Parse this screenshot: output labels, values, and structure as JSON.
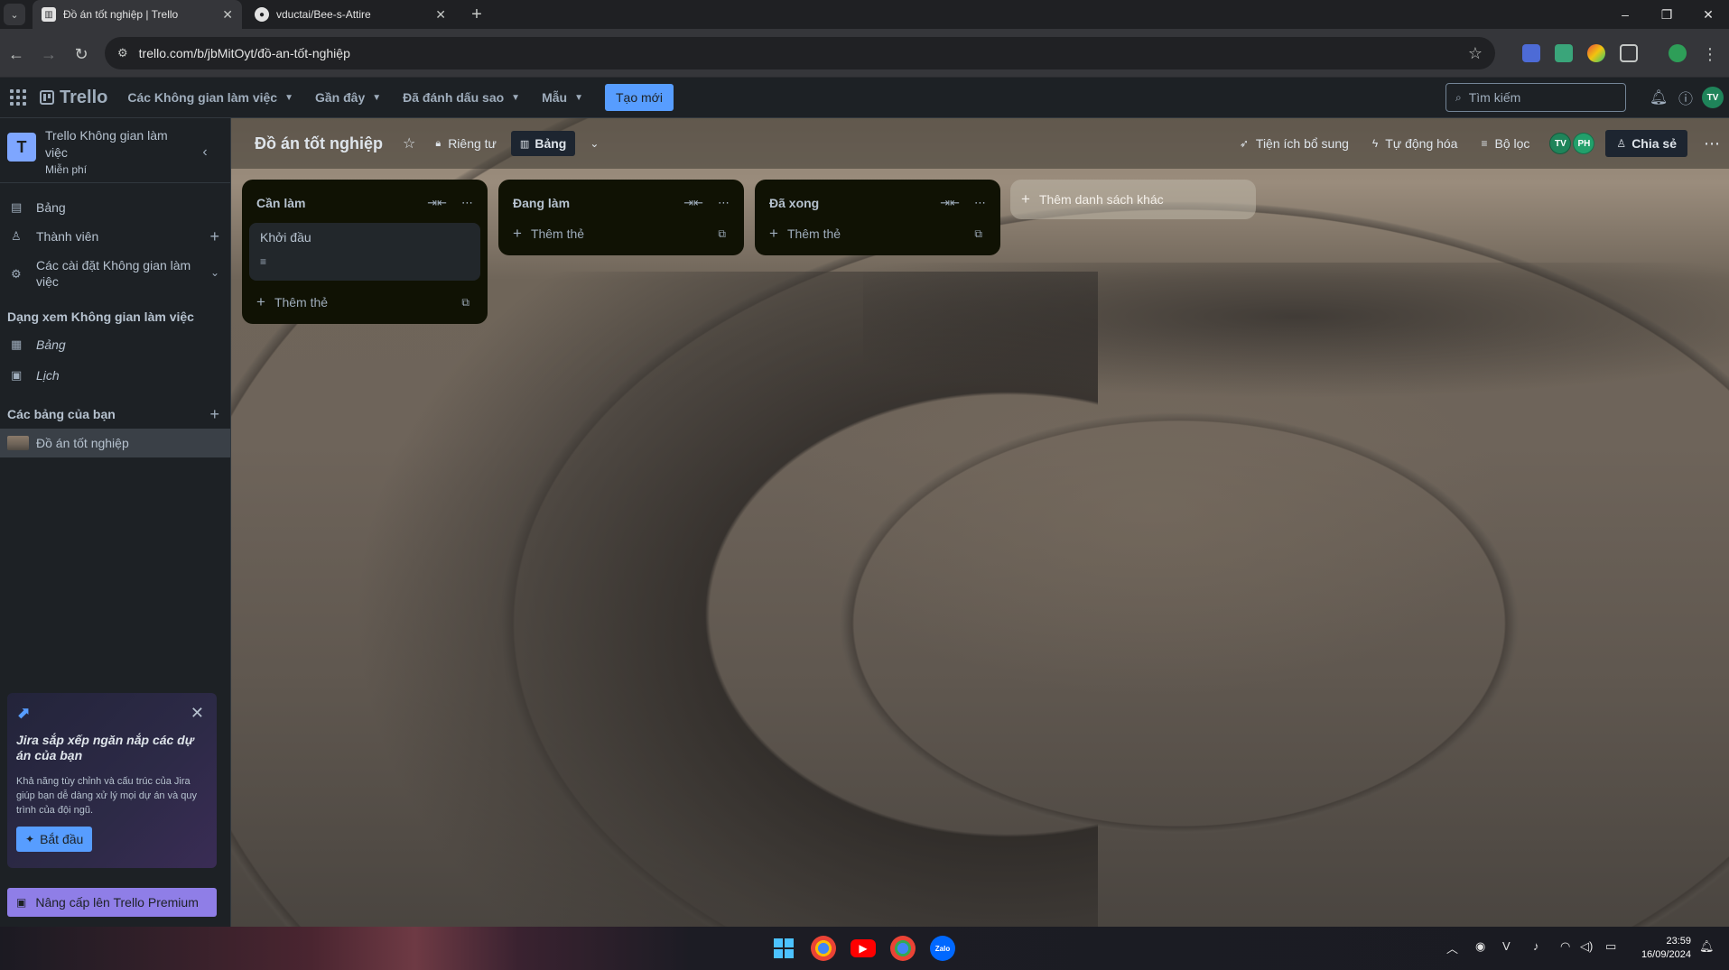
{
  "browser": {
    "tabs": [
      {
        "title": "Đồ án tốt nghiệp | Trello",
        "active": true,
        "favicon": "trello-icon"
      },
      {
        "title": "vductai/Bee-s-Attire",
        "active": false,
        "favicon": "github-icon"
      }
    ],
    "url": "trello.com/b/jbMitOyt/đồ-an-tốt-nghiệp",
    "window_controls": {
      "minimize": "–",
      "restore": "❐",
      "close": "✕"
    }
  },
  "header": {
    "logo": "Trello",
    "menus": [
      {
        "label": "Các Không gian làm việc"
      },
      {
        "label": "Gần đây"
      },
      {
        "label": "Đã đánh dấu sao"
      },
      {
        "label": "Mẫu"
      }
    ],
    "create_label": "Tạo mới",
    "search_placeholder": "Tìm kiếm",
    "user_initials": "TV"
  },
  "sidebar": {
    "workspace": {
      "initial": "T",
      "name": "Trello Không gian làm việc",
      "plan": "Miễn phí"
    },
    "items": [
      {
        "label": "Bảng",
        "icon": "board-icon"
      },
      {
        "label": "Thành viên",
        "icon": "person-icon"
      },
      {
        "label": "Các cài đặt Không gian làm việc",
        "icon": "gear-icon"
      }
    ],
    "views_title": "Dạng xem Không gian làm việc",
    "views": [
      {
        "label": "Bảng",
        "icon": "table-icon"
      },
      {
        "label": "Lịch",
        "icon": "calendar-icon"
      }
    ],
    "boards_title": "Các bảng của bạn",
    "boards": [
      {
        "label": "Đồ án tốt nghiệp"
      }
    ],
    "jira_promo": {
      "title": "Jira sắp xếp ngăn nắp các dự án của bạn",
      "body": "Khả năng tùy chỉnh và cấu trúc của Jira giúp bạn dễ dàng xử lý mọi dự án và quy trình của đội ngũ.",
      "button": "Bắt đầu"
    },
    "premium_label": "Nâng cấp lên Trello Premium"
  },
  "board": {
    "title": "Đồ án tốt nghiệp",
    "visibility": "Riêng tư",
    "view": "Bảng",
    "actions": {
      "powerups": "Tiện ích bổ sung",
      "automation": "Tự động hóa",
      "filter": "Bộ lọc",
      "share": "Chia sẻ"
    },
    "members": [
      {
        "initials": "TV",
        "color": "#1f845a"
      },
      {
        "initials": "PH",
        "color": "#22a06b"
      }
    ],
    "lists": [
      {
        "title": "Cần làm",
        "cards": [
          {
            "title": "Khởi đầu",
            "has_description": true
          }
        ],
        "add_card": "Thêm thẻ"
      },
      {
        "title": "Đang làm",
        "cards": [],
        "add_card": "Thêm thẻ"
      },
      {
        "title": "Đã xong",
        "cards": [],
        "add_card": "Thêm thẻ"
      }
    ],
    "add_list": "Thêm danh sách khác"
  },
  "taskbar": {
    "time": "23:59",
    "date": "16/09/2024",
    "apps": [
      "windows-start-icon",
      "chrome-icon",
      "youtube-icon",
      "chrome-profile-icon",
      "zalo-icon"
    ],
    "zalo_label": "Zalo"
  }
}
